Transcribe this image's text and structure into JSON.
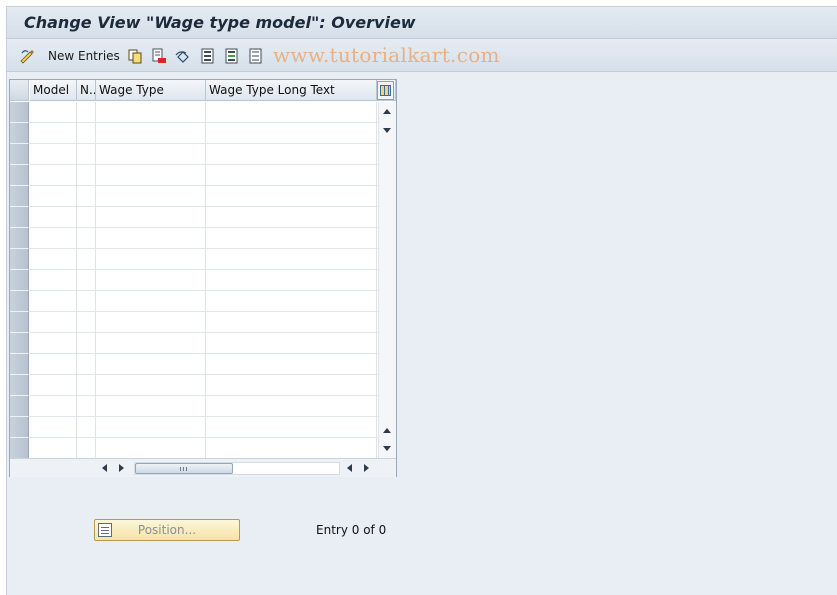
{
  "title": "Change View \"Wage type model\": Overview",
  "toolbar": {
    "new_entries_label": "New Entries",
    "watermark": "www.tutorialkart.com",
    "icons": [
      "display-change-icon",
      "copy-icon",
      "delete-icon",
      "undo-icon",
      "select-all-icon",
      "select-block-icon",
      "deselect-all-icon"
    ]
  },
  "table": {
    "columns": [
      "Model",
      "N..",
      "Wage Type",
      "Wage Type Long Text"
    ],
    "rows": [
      [
        "",
        "",
        "",
        ""
      ],
      [
        "",
        "",
        "",
        ""
      ],
      [
        "",
        "",
        "",
        ""
      ],
      [
        "",
        "",
        "",
        ""
      ],
      [
        "",
        "",
        "",
        ""
      ],
      [
        "",
        "",
        "",
        ""
      ],
      [
        "",
        "",
        "",
        ""
      ],
      [
        "",
        "",
        "",
        ""
      ],
      [
        "",
        "",
        "",
        ""
      ],
      [
        "",
        "",
        "",
        ""
      ],
      [
        "",
        "",
        "",
        ""
      ],
      [
        "",
        "",
        "",
        ""
      ],
      [
        "",
        "",
        "",
        ""
      ],
      [
        "",
        "",
        "",
        ""
      ],
      [
        "",
        "",
        "",
        ""
      ],
      [
        "",
        "",
        "",
        ""
      ],
      [
        "",
        "",
        "",
        ""
      ]
    ]
  },
  "footer": {
    "position_label": "Position...",
    "entry_text": "Entry 0 of 0"
  },
  "colors": {
    "background": "#e9eef4",
    "position_button": "#f3e4a6",
    "watermark": "#eaa873"
  }
}
